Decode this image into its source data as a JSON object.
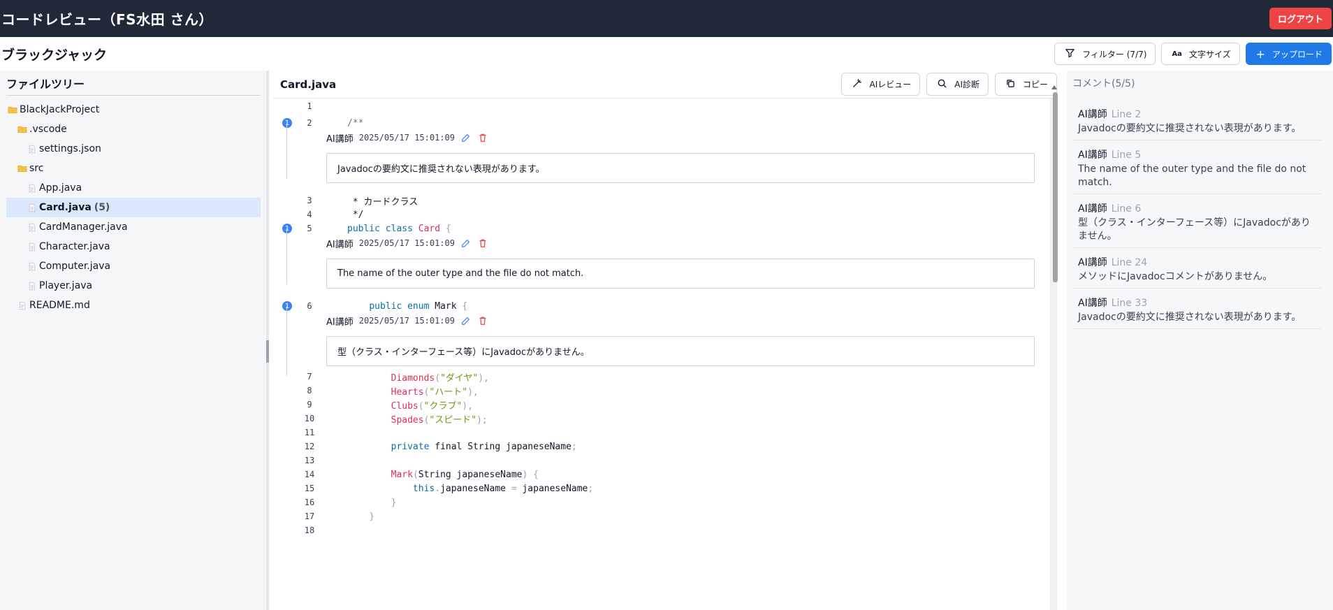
{
  "header": {
    "title": "コードレビュー（FS水田 さん）",
    "logout_label": "ログアウト"
  },
  "project": {
    "title": "ブラックジャック"
  },
  "toolbar": {
    "filter_label": "フィルター (7/7)",
    "font_size_label": "文字サイズ",
    "upload_label": "アップロード"
  },
  "filetree": {
    "title": "ファイルツリー",
    "nodes": [
      {
        "label": "BlackJackProject",
        "kind": "folder",
        "depth": 0
      },
      {
        "label": ".vscode",
        "kind": "folder",
        "depth": 1
      },
      {
        "label": "settings.json",
        "kind": "file",
        "depth": 2
      },
      {
        "label": "src",
        "kind": "folder",
        "depth": 1
      },
      {
        "label": "App.java",
        "kind": "file",
        "depth": 2
      },
      {
        "label": "Card.java",
        "kind": "file",
        "depth": 2,
        "count": "(5)",
        "selected": true
      },
      {
        "label": "CardManager.java",
        "kind": "file",
        "depth": 2
      },
      {
        "label": "Character.java",
        "kind": "file",
        "depth": 2
      },
      {
        "label": "Computer.java",
        "kind": "file",
        "depth": 2
      },
      {
        "label": "Player.java",
        "kind": "file",
        "depth": 2
      },
      {
        "label": "README.md",
        "kind": "file",
        "depth": 1
      }
    ]
  },
  "editor": {
    "filename": "Card.java",
    "ai_review_label": "AIレビュー",
    "ai_diagnose_label": "AI診断",
    "copy_label": "コピー",
    "badge_count": "1",
    "comments": [
      {
        "author": "AI講師",
        "date": "2025/05/17 15:01:09",
        "text": "Javadocの要約文に推奨されない表現があります。"
      },
      {
        "author": "AI講師",
        "date": "2025/05/17 15:01:09",
        "text": "The name of the outer type and the file do not match."
      },
      {
        "author": "AI講師",
        "date": "2025/05/17 15:01:09",
        "text": "型（クラス・インターフェース等）にJavadocがありません。"
      }
    ],
    "line_numbers": [
      "1",
      "2",
      "3",
      "4",
      "5",
      "6",
      "7",
      "8",
      "9",
      "10",
      "11",
      "12",
      "13",
      "14",
      "15",
      "16",
      "17",
      "18"
    ]
  },
  "comments_panel": {
    "title": "コメント(5/5)",
    "items": [
      {
        "author": "AI講師",
        "line": "Line 2",
        "text": "Javadocの要約文に推奨されない表現があります。"
      },
      {
        "author": "AI講師",
        "line": "Line 5",
        "text": "The name of the outer type and the file do not match."
      },
      {
        "author": "AI講師",
        "line": "Line 6",
        "text": "型（クラス・インターフェース等）にJavadocがありません。"
      },
      {
        "author": "AI講師",
        "line": "Line 24",
        "text": "メソッドにJavadocコメントがありません。"
      },
      {
        "author": "AI講師",
        "line": "Line 33",
        "text": "Javadocの要約文に推奨されない表現があります。"
      }
    ]
  },
  "colors": {
    "header_bg": "#1f2937",
    "logout": "#ef4444",
    "primary": "#1f7ae8",
    "selected_row": "#dbe7fb",
    "badge": "#3b82f6"
  }
}
